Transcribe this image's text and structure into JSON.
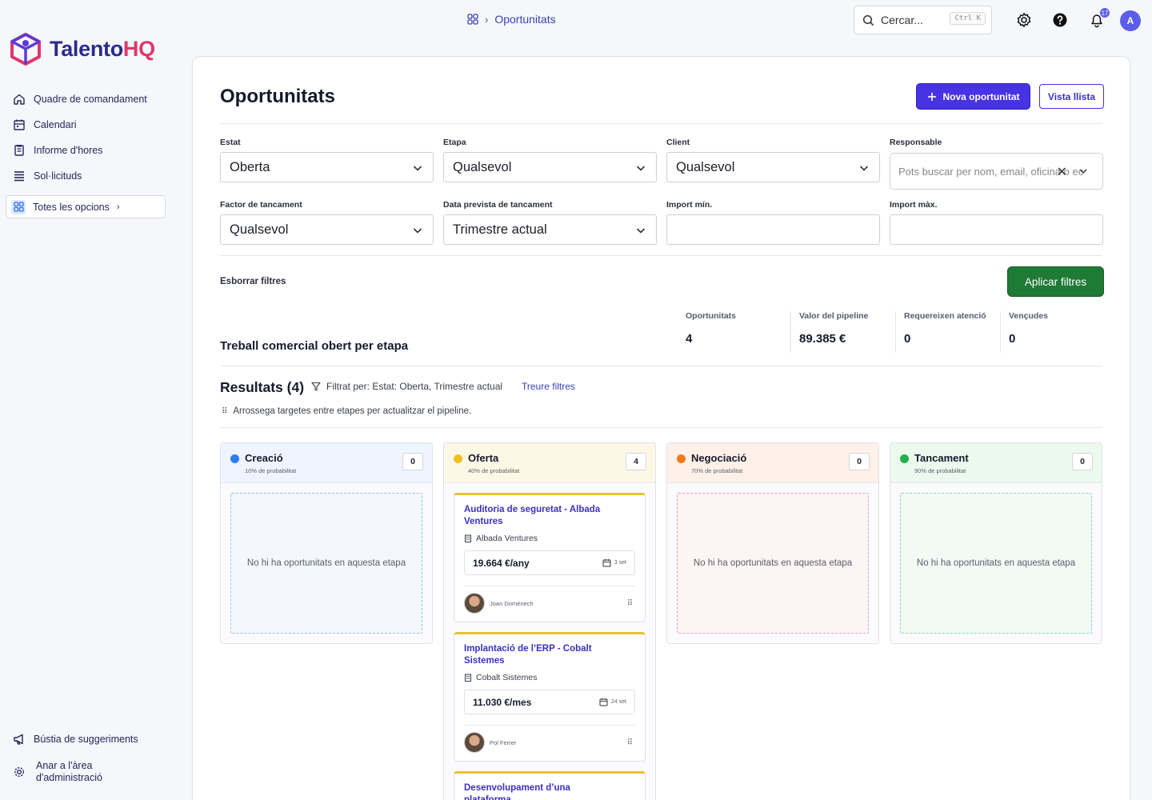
{
  "brand": {
    "name_part1": "Talento",
    "name_part2": "HQ",
    "accent": "#4833e4",
    "brand_pink": "#e0366a"
  },
  "sidebar": {
    "items": [
      {
        "label": "Quadre de comandament",
        "icon": "home-icon"
      },
      {
        "label": "Calendari",
        "icon": "calendar-icon"
      },
      {
        "label": "Informe d'hores",
        "icon": "report-icon"
      },
      {
        "label": "Sol·licituds",
        "icon": "list-icon"
      }
    ],
    "all_options": "Totes les opcions",
    "bottom": [
      {
        "label": "Bústia de suggeriments",
        "icon": "megaphone-icon"
      },
      {
        "label": "Anar a l'àrea d'administració",
        "icon": "gear-icon"
      }
    ]
  },
  "topbar": {
    "breadcrumb": "Oportunitats",
    "search_placeholder": "Cercar...",
    "search_shortcut": "Ctrl K",
    "notification_count": "17",
    "avatar_initial": "A"
  },
  "page": {
    "title": "Oportunitats",
    "new_button": "Nova oportunitat",
    "list_button": "Vista llista"
  },
  "filters": {
    "estat": {
      "label": "Estat",
      "value": "Oberta"
    },
    "etapa": {
      "label": "Etapa",
      "value": "Qualsevol"
    },
    "client": {
      "label": "Client",
      "value": "Qualsevol"
    },
    "responsable": {
      "label": "Responsable",
      "placeholder": "Pots buscar per nom, email, oficina o ec"
    },
    "factor": {
      "label": "Factor de tancament",
      "value": "Qualsevol"
    },
    "data": {
      "label": "Data prevista de tancament",
      "value": "Trimestre actual"
    },
    "import_min": {
      "label": "Import mín."
    },
    "import_max": {
      "label": "Import màx."
    },
    "clear": "Esborrar filtres",
    "apply": "Aplicar filtres"
  },
  "summary": {
    "title": "Treball comercial obert per etapa",
    "stats": [
      {
        "label": "Oportunitats",
        "value": "4"
      },
      {
        "label": "Valor del pipeline",
        "value": "89.385 €"
      },
      {
        "label": "Requereixen atenció",
        "value": "0"
      },
      {
        "label": "Vençudes",
        "value": "0"
      }
    ]
  },
  "results": {
    "title": "Resultats (4)",
    "filter_text": "Filtrat per: Estat: Oberta, Trimestre actual",
    "remove_filters": "Treure filtres",
    "hint": "Arrossega targetes entre etapes per actualitzar el pipeline."
  },
  "columns": [
    {
      "name": "Creació",
      "probability": "10% de probabilitat",
      "count": "0",
      "color": "#2f7cf6",
      "head_bg": "#eef5ff",
      "empty_border": "#8fc0e0",
      "empty_text": "No hi ha oportunitats en aquesta etapa"
    },
    {
      "name": "Oferta",
      "probability": "40% de probabilitat",
      "count": "4",
      "color": "#f0c020",
      "head_bg": "#fdf8e6"
    },
    {
      "name": "Negociació",
      "probability": "70% de probabilitat",
      "count": "0",
      "color": "#f07a1e",
      "head_bg": "#fff1e8",
      "empty_border": "#e0a0c8",
      "empty_text": "No hi ha oportunitats en aquesta etapa"
    },
    {
      "name": "Tancament",
      "probability": "90% de probabilitat",
      "count": "0",
      "color": "#22b04a",
      "head_bg": "#ecf9ee",
      "empty_border": "#90d0b8",
      "empty_text": "No hi ha oportunitats en aquesta etapa"
    }
  ],
  "cards": [
    {
      "title": "Auditoria de seguretat - Albada Ventures",
      "client": "Albada Ventures",
      "amount": "19.664 €/any",
      "date": "3 set",
      "owner": "Joan Domènech"
    },
    {
      "title": "Implantació de l’ERP - Cobalt Sistemes",
      "client": "Cobalt Sistemes",
      "amount": "11.030 €/mes",
      "date": "24 set",
      "owner": "Pol Ferrer"
    },
    {
      "title": "Desenvolupament d’una plataforma"
    }
  ]
}
